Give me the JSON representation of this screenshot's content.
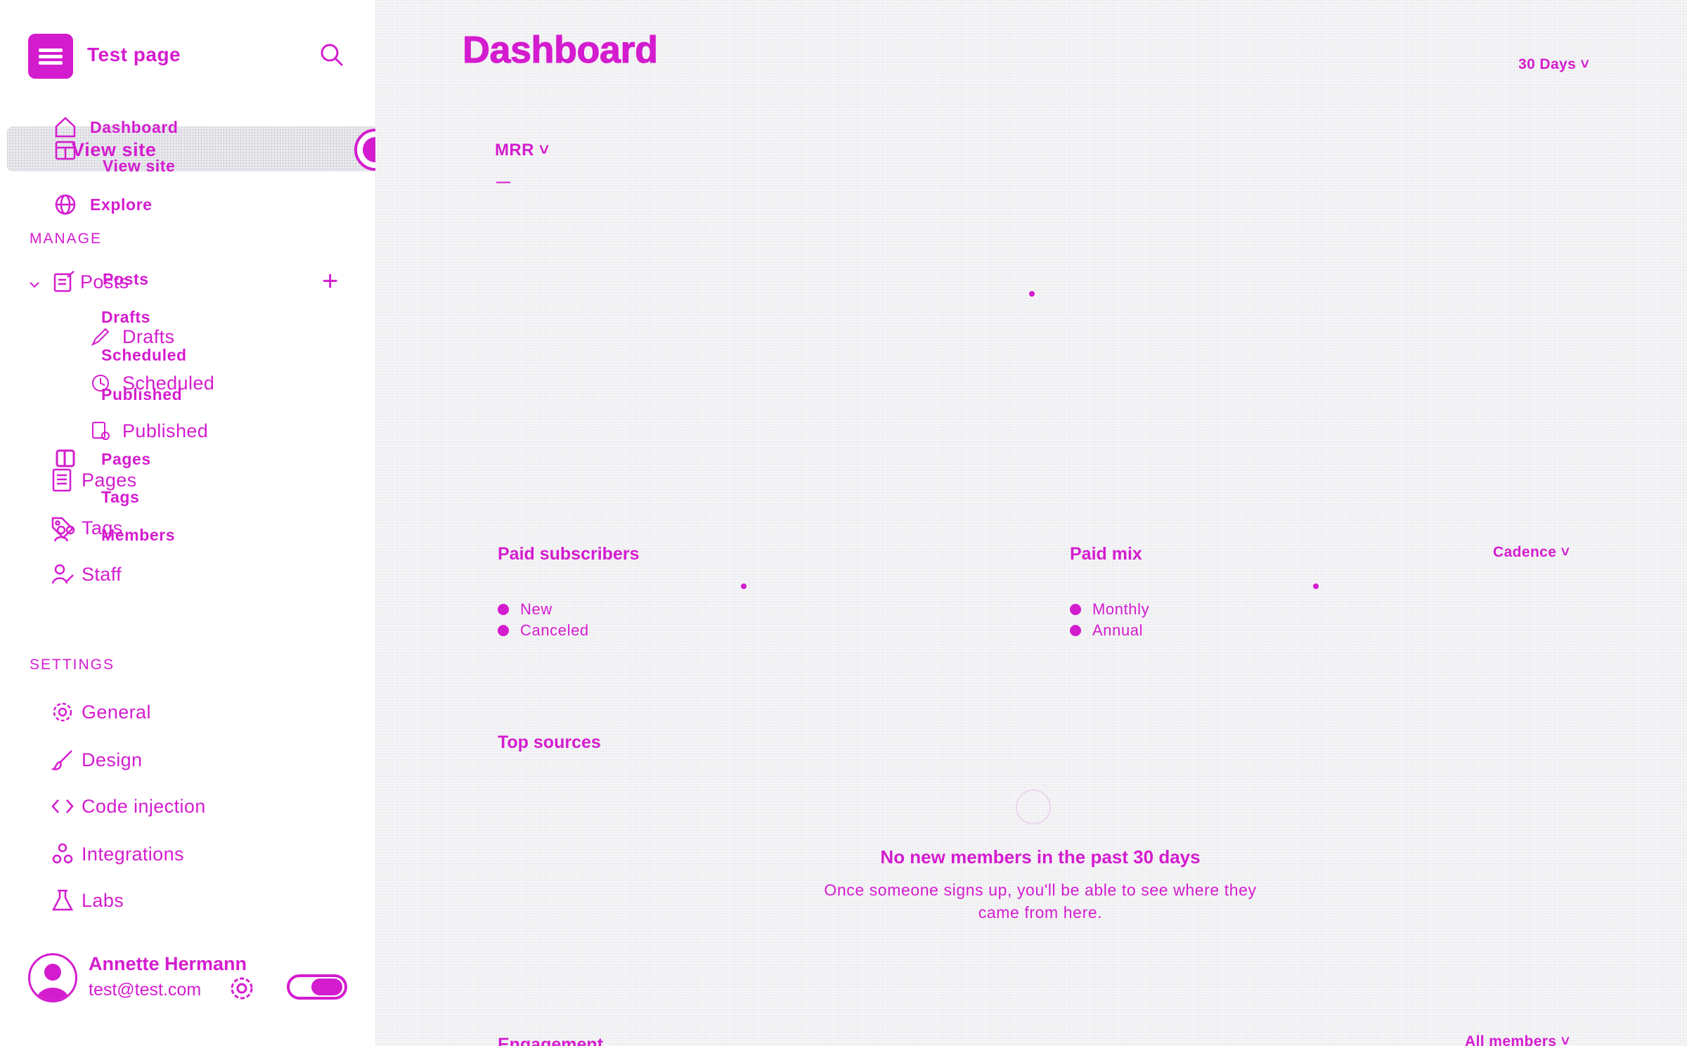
{
  "sidebar": {
    "site_title": "Test page",
    "nav": {
      "dashboard": "Dashboard",
      "view_site": "View site",
      "explore": "Explore"
    },
    "manage_header": "MANAGE",
    "posts": "Posts",
    "post_sub": {
      "drafts": "Drafts",
      "scheduled": "Scheduled",
      "published": "Published"
    },
    "pages": "Pages",
    "tags": "Tags",
    "members": "Members",
    "staff": "Staff",
    "settings_header": "SETTINGS",
    "settings": {
      "general": "General",
      "design": "Design",
      "code_injection": "Code injection",
      "integrations": "Integrations",
      "labs": "Labs"
    },
    "user": {
      "name": "Annette Hermann",
      "email": "test@test.com"
    }
  },
  "main": {
    "title": "Dashboard",
    "range_select": "30 Days",
    "mrr_select": "MRR",
    "mrr_value": "—",
    "paid_subscribers": {
      "title": "Paid subscribers",
      "legend": [
        "New",
        "Canceled"
      ]
    },
    "paid_mix": {
      "title": "Paid mix",
      "select": "Cadence",
      "legend": [
        "Monthly",
        "Annual"
      ]
    },
    "top_sources": {
      "title": "Top sources",
      "empty_title": "No new members in the past 30 days",
      "empty_text_line1": "Once someone signs up, you'll be able to see where they",
      "empty_text_line2": "came from here."
    },
    "engagement": {
      "title": "Engagement",
      "select": "All members"
    }
  },
  "colors": {
    "accent": "#d41ccf",
    "main_bg": "#f6f6f8",
    "sidebar_bg": "#ffffff"
  },
  "icons": {
    "dashboard": "house-icon",
    "view_site": "browser-icon",
    "explore": "globe-icon",
    "posts": "edit-doc-icon",
    "drafts": "pencil-icon",
    "scheduled": "clock-icon",
    "published": "doc-check-icon",
    "pages": "pages-icon",
    "tags": "tag-icon",
    "members": "members-icon",
    "staff": "staff-icon",
    "general": "gear-icon",
    "design": "brush-icon",
    "code_injection": "code-icon",
    "integrations": "integrations-icon",
    "labs": "flask-icon"
  }
}
